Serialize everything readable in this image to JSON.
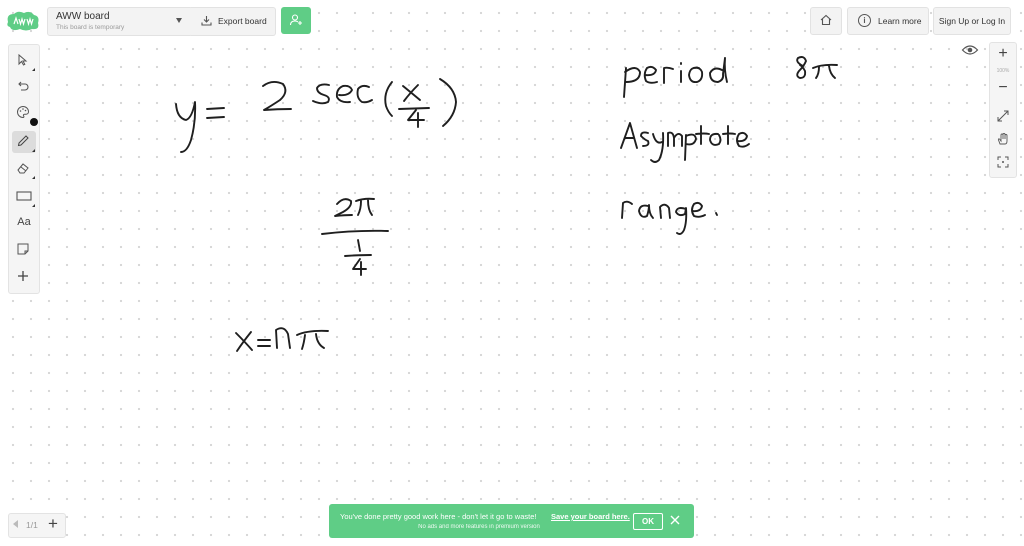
{
  "header": {
    "board_title": "AWW board",
    "board_subtitle": "This board is temporary",
    "export_label": "Export board",
    "learn_more_label": "Learn more",
    "sign_in_label": "Sign Up or Log In"
  },
  "toolbar": {
    "text_tool_label": "Aa"
  },
  "zoom": {
    "plus": "+",
    "percent": "100%",
    "minus": "−"
  },
  "pager": {
    "count": "1/1",
    "add": "+"
  },
  "banner": {
    "message": "You've done pretty good work here - don't let it go to waste!",
    "link": "Save your board here.",
    "sub": "No ads and more features in premium version",
    "ok_label": "OK"
  },
  "colors": {
    "accent": "#5fcd86",
    "ink": "#1f1f1f",
    "toolbar_bg": "#f5f5f5"
  }
}
